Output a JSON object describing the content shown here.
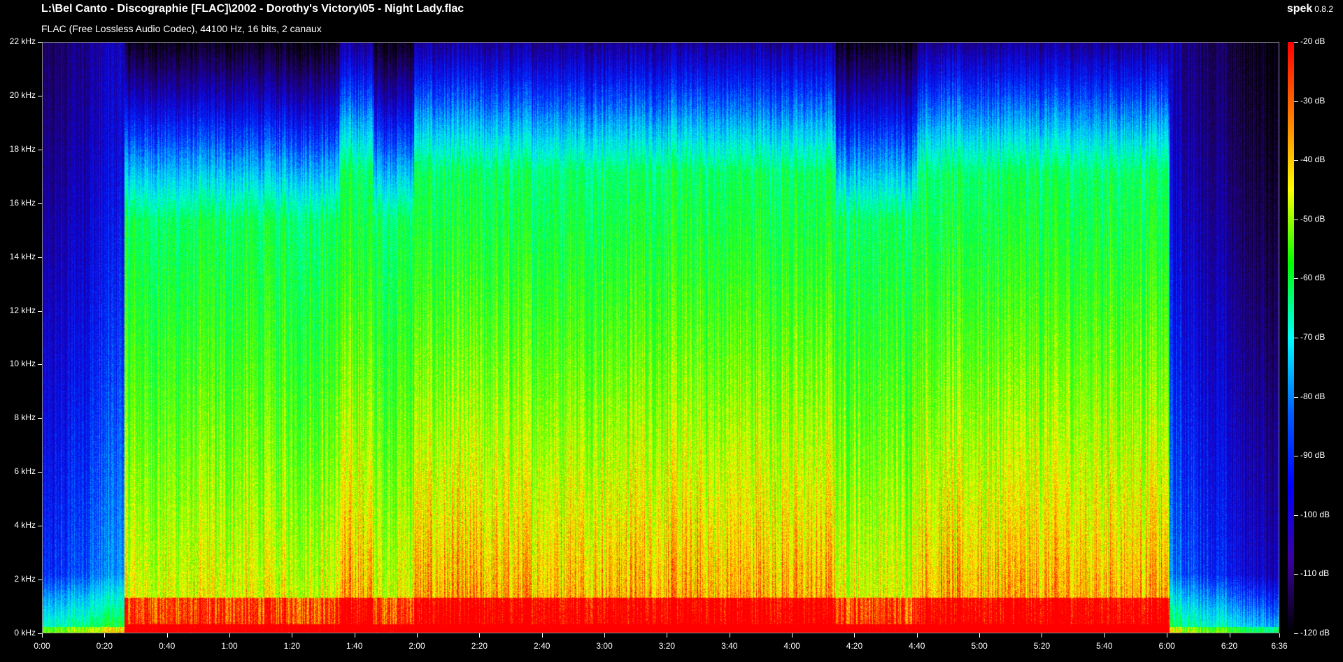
{
  "window": {
    "file_path": "L:\\Bel Canto - Discographie [FLAC]\\2002 - Dorothy's Victory\\05 - Night Lady.flac",
    "file_info": "FLAC (Free Lossless Audio Codec), 44100 Hz, 16 bits, 2 canaux",
    "app_name": "spek",
    "app_version": "0.8.2"
  },
  "frequency_axis": {
    "unit": "kHz",
    "ticks": [
      {
        "value": 0,
        "label": "0 kHz"
      },
      {
        "value": 2,
        "label": "2 kHz"
      },
      {
        "value": 4,
        "label": "4 kHz"
      },
      {
        "value": 6,
        "label": "6 kHz"
      },
      {
        "value": 8,
        "label": "8 kHz"
      },
      {
        "value": 10,
        "label": "10 kHz"
      },
      {
        "value": 12,
        "label": "12 kHz"
      },
      {
        "value": 14,
        "label": "14 kHz"
      },
      {
        "value": 16,
        "label": "16 kHz"
      },
      {
        "value": 18,
        "label": "18 kHz"
      },
      {
        "value": 20,
        "label": "20 kHz"
      },
      {
        "value": 22,
        "label": "22 kHz"
      }
    ],
    "max": 22
  },
  "time_axis": {
    "duration_seconds": 396,
    "ticks": [
      {
        "value": 0,
        "label": "0:00"
      },
      {
        "value": 20,
        "label": "0:20"
      },
      {
        "value": 40,
        "label": "0:40"
      },
      {
        "value": 60,
        "label": "1:00"
      },
      {
        "value": 80,
        "label": "1:20"
      },
      {
        "value": 100,
        "label": "1:40"
      },
      {
        "value": 120,
        "label": "2:00"
      },
      {
        "value": 140,
        "label": "2:20"
      },
      {
        "value": 160,
        "label": "2:40"
      },
      {
        "value": 180,
        "label": "3:00"
      },
      {
        "value": 200,
        "label": "3:20"
      },
      {
        "value": 220,
        "label": "3:40"
      },
      {
        "value": 240,
        "label": "4:00"
      },
      {
        "value": 260,
        "label": "4:20"
      },
      {
        "value": 280,
        "label": "4:40"
      },
      {
        "value": 300,
        "label": "5:00"
      },
      {
        "value": 320,
        "label": "5:20"
      },
      {
        "value": 340,
        "label": "5:40"
      },
      {
        "value": 360,
        "label": "6:00"
      },
      {
        "value": 380,
        "label": "6:20"
      },
      {
        "value": 396,
        "label": "6:36"
      }
    ]
  },
  "db_scale": {
    "min": -120,
    "max": -20,
    "ticks": [
      {
        "value": -20,
        "label": "-20 dB"
      },
      {
        "value": -30,
        "label": "-30 dB"
      },
      {
        "value": -40,
        "label": "-40 dB"
      },
      {
        "value": -50,
        "label": "-50 dB"
      },
      {
        "value": -60,
        "label": "-60 dB"
      },
      {
        "value": -70,
        "label": "-70 dB"
      },
      {
        "value": -80,
        "label": "-80 dB"
      },
      {
        "value": -90,
        "label": "-90 dB"
      },
      {
        "value": -100,
        "label": "-100 dB"
      },
      {
        "value": -110,
        "label": "-110 dB"
      },
      {
        "value": -120,
        "label": "-120 dB"
      }
    ],
    "gradient_colors": [
      "#ff0000",
      "#ff7a00",
      "#ffff00",
      "#00ff00",
      "#00ffff",
      "#0060ff",
      "#0000ff",
      "#3a00a0",
      "#000000"
    ]
  },
  "spectrogram": {
    "loud_sections": [
      {
        "start": 26,
        "end": 95,
        "level": "medium"
      },
      {
        "start": 95,
        "end": 106,
        "level": "high"
      },
      {
        "start": 106,
        "end": 119,
        "level": "medium"
      },
      {
        "start": 119,
        "end": 203,
        "level": "high"
      },
      {
        "start": 203,
        "end": 227,
        "level": "high"
      },
      {
        "start": 227,
        "end": 254,
        "level": "high"
      },
      {
        "start": 254,
        "end": 280,
        "level": "medium"
      },
      {
        "start": 280,
        "end": 361,
        "level": "high"
      }
    ],
    "colors": {
      "background": "#000000",
      "border": "#8a8a8a"
    }
  }
}
